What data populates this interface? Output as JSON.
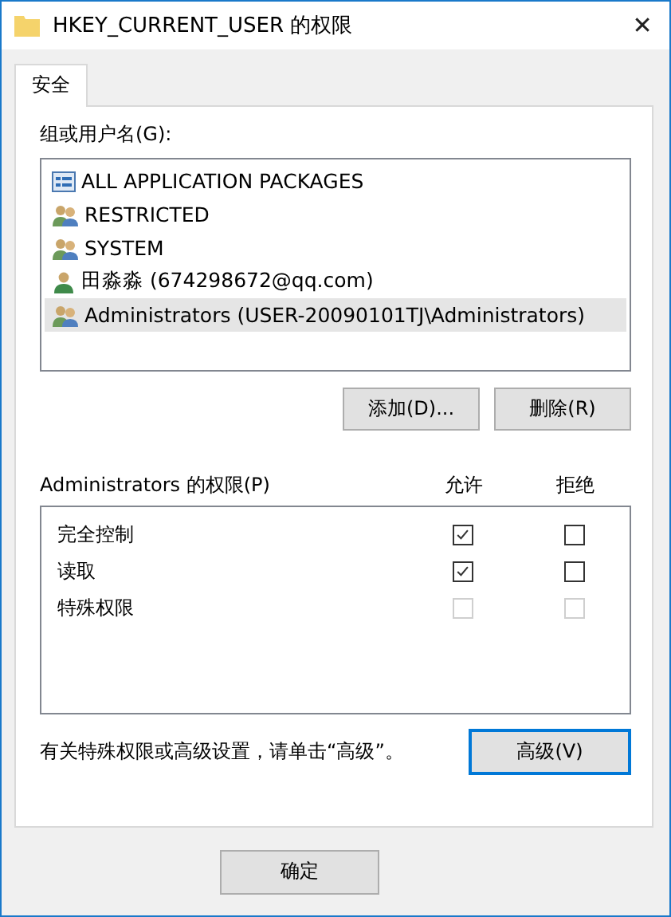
{
  "window": {
    "title": "HKEY_CURRENT_USER 的权限",
    "close": "✕"
  },
  "tabs": [
    {
      "label": "安全",
      "selected": true
    }
  ],
  "groups": {
    "label": "组或用户名(G):",
    "items": [
      {
        "kind": "package",
        "name": "ALL APPLICATION PACKAGES",
        "selected": false
      },
      {
        "kind": "group",
        "name": "RESTRICTED",
        "selected": false
      },
      {
        "kind": "group",
        "name": "SYSTEM",
        "selected": false
      },
      {
        "kind": "user",
        "name": "田淼淼 (674298672@qq.com)",
        "selected": false
      },
      {
        "kind": "group",
        "name": "Administrators (USER-20090101TJ\\Administrators)",
        "selected": true
      }
    ],
    "buttons": [
      "添加(D)...",
      "删除(R)"
    ]
  },
  "permissions": {
    "label": "Administrators 的权限(P)",
    "allow_header": "允许",
    "deny_header": "拒绝",
    "rows": [
      {
        "name": "完全控制",
        "allow": true,
        "deny": false,
        "disabled": false
      },
      {
        "name": "读取",
        "allow": true,
        "deny": false,
        "disabled": false
      },
      {
        "name": "特殊权限",
        "allow": false,
        "deny": false,
        "disabled": true
      }
    ]
  },
  "advanced": {
    "note": "有关特殊权限或高级设置，请单击“高级”。",
    "button": "高级(V)"
  },
  "footer_buttons": [
    "确定"
  ]
}
